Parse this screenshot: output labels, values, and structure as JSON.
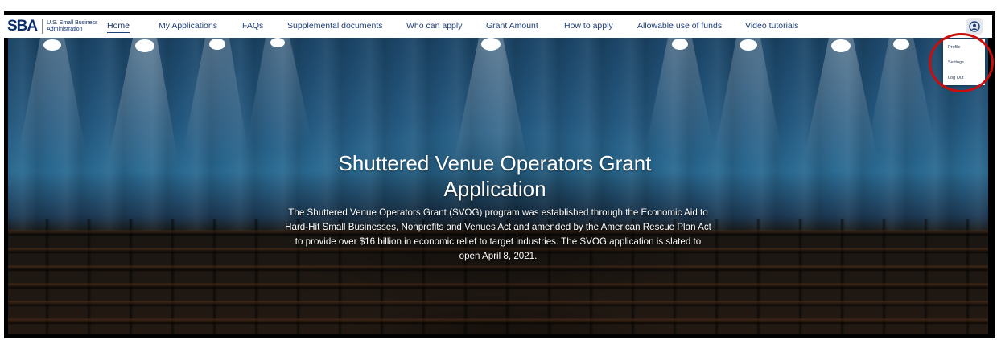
{
  "header": {
    "logo": {
      "mark": "SBA",
      "line1": "U.S. Small Business",
      "line2": "Administration"
    },
    "nav": [
      {
        "label": "Home",
        "active": true
      },
      {
        "label": "My Applications",
        "active": false
      },
      {
        "label": "FAQs",
        "active": false
      },
      {
        "label": "Supplemental documents",
        "active": false
      },
      {
        "label": "Who can apply",
        "active": false
      },
      {
        "label": "Grant Amount",
        "active": false
      },
      {
        "label": "How to apply",
        "active": false
      },
      {
        "label": "Allowable use of funds",
        "active": false
      },
      {
        "label": "Video tutorials",
        "active": false
      }
    ],
    "user_icon": "user-circle-icon"
  },
  "user_menu": {
    "items": [
      "Profile",
      "Settings",
      "Log Out"
    ]
  },
  "hero": {
    "title_line1": "Shuttered Venue Operators Grant",
    "title_line2": "Application",
    "body_line1": "The Shuttered Venue Operators Grant (SVOG) program was established through the Economic Aid to",
    "body_line2": "Hard-Hit Small Businesses, Nonprofits and Venues Act and amended by the American Rescue Plan Act",
    "body_line3": "to provide over $16 billion in economic relief to target industries. The SVOG application is slated to",
    "body_line4": "open April 8, 2021."
  },
  "colors": {
    "nav_text": "#1f3e7a",
    "highlight": "#cc0d0d",
    "logo_blue": "#0b2e6b",
    "logo_red": "#c41e3a"
  }
}
